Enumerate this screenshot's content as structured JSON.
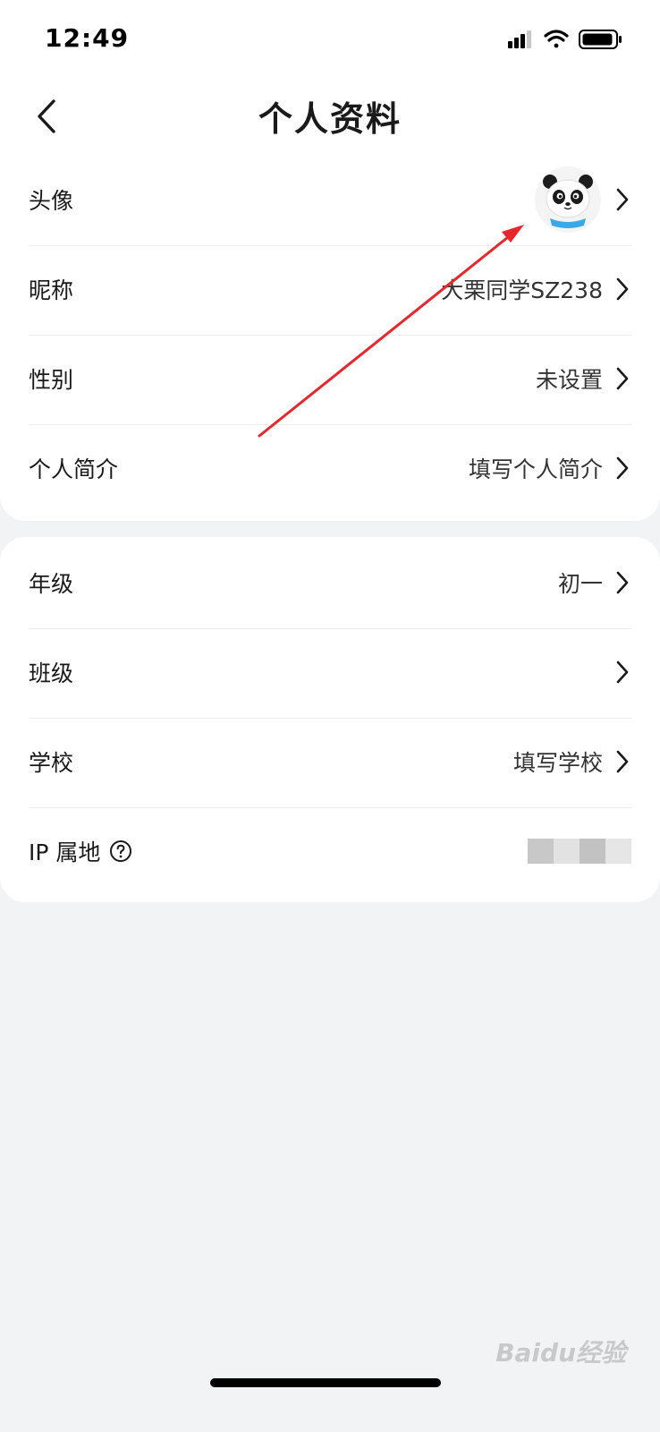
{
  "status_bar": {
    "time": "12:49"
  },
  "header": {
    "title": "个人资料"
  },
  "basic_section": {
    "avatar_label": "头像",
    "nickname_label": "昵称",
    "nickname_value": "大栗同学SZ238",
    "gender_label": "性别",
    "gender_value": "未设置",
    "bio_label": "个人简介",
    "bio_value": "填写个人简介"
  },
  "school_section": {
    "grade_label": "年级",
    "grade_value": "初一",
    "class_label": "班级",
    "class_value": "",
    "school_label": "学校",
    "school_value": "填写学校",
    "ip_label": "IP 属地"
  },
  "watermark": {
    "text": "Baidu经验"
  },
  "colors": {
    "annotation_arrow": "#e8262b",
    "page_bg": "#f2f3f5",
    "card_bg": "#ffffff"
  }
}
